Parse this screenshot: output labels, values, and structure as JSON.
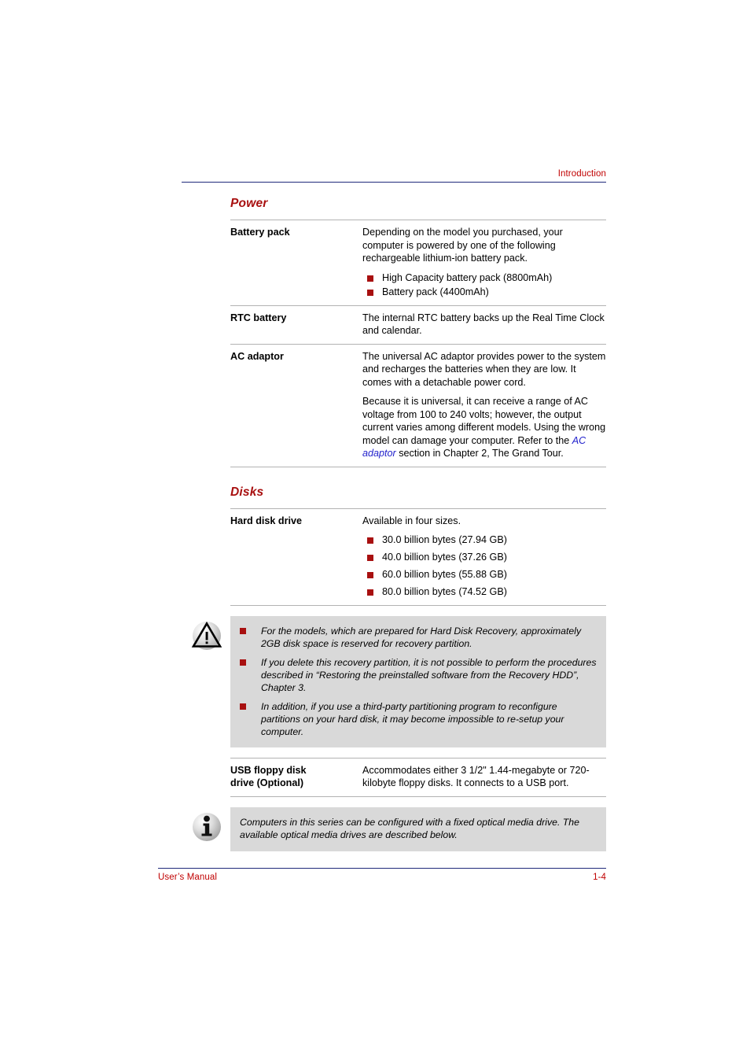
{
  "header": {
    "chapter_title": "Introduction",
    "rule_color": "#1F2A7A",
    "text_color": "#C00000"
  },
  "accent": {
    "heading_red": "#A81010",
    "bullet_red": "#A81010",
    "link_blue": "#2222CC",
    "callout_bg": "#D9D9D9"
  },
  "sections": [
    {
      "heading": "Power",
      "rows": [
        {
          "term": "Battery pack",
          "paragraphs": [
            "Depending on the model you purchased, your computer is powered by one of the following rechargeable lithium-ion battery pack."
          ],
          "bullets": [
            "High Capacity battery pack (8800mAh)",
            "Battery pack (4400mAh)"
          ]
        },
        {
          "term": "RTC battery",
          "paragraphs": [
            "The internal RTC battery backs up the Real Time Clock and calendar."
          ],
          "bullets": []
        },
        {
          "term": "AC adaptor",
          "paragraphs": [
            "The universal AC adaptor provides power to the system and recharges the batteries when they are low. It comes with a detachable power cord."
          ],
          "paragraph2_part1": "Because it is universal, it can receive a range of AC voltage from 100 to 240 volts; however, the output current varies among different models. Using the wrong model can damage your computer. Refer to the ",
          "paragraph2_link": "AC adaptor",
          "paragraph2_part2": " section in Chapter 2, The Grand Tour.",
          "bullets": []
        }
      ]
    },
    {
      "heading": "Disks",
      "rows": [
        {
          "term": "Hard disk drive",
          "paragraphs": [
            "Available in four sizes."
          ],
          "bullets": [
            "30.0 billion bytes (27.94 GB)",
            "40.0 billion bytes (37.26 GB)",
            "60.0 billion bytes (55.88 GB)",
            "80.0 billion bytes (74.52 GB)"
          ]
        }
      ]
    }
  ],
  "caution_callout": {
    "icon": "warning-triangle-icon",
    "bullets": [
      "For the models, which are prepared for Hard Disk Recovery, approximately 2GB disk space is reserved for recovery partition.",
      "If you delete this recovery partition, it is not possible to perform the procedures described in  “Restoring the preinstalled software from the Recovery HDD”, Chapter 3.",
      "In addition, if you use a third-party partitioning program to reconfigure partitions on your hard disk, it may become impossible to re-setup your computer."
    ]
  },
  "usb_row": {
    "term_line1": "USB floppy disk",
    "term_line2": "drive (Optional)",
    "description": "Accommodates either 3 1/2\" 1.44-megabyte or 720-kilobyte floppy disks. It connects to a USB port."
  },
  "info_callout": {
    "icon": "info-circle-icon",
    "text": "Computers in this series can be configured with a fixed optical media drive. The available optical media drives are described below."
  },
  "footer": {
    "manual_label": "User’s Manual",
    "page_number": "1-4"
  }
}
